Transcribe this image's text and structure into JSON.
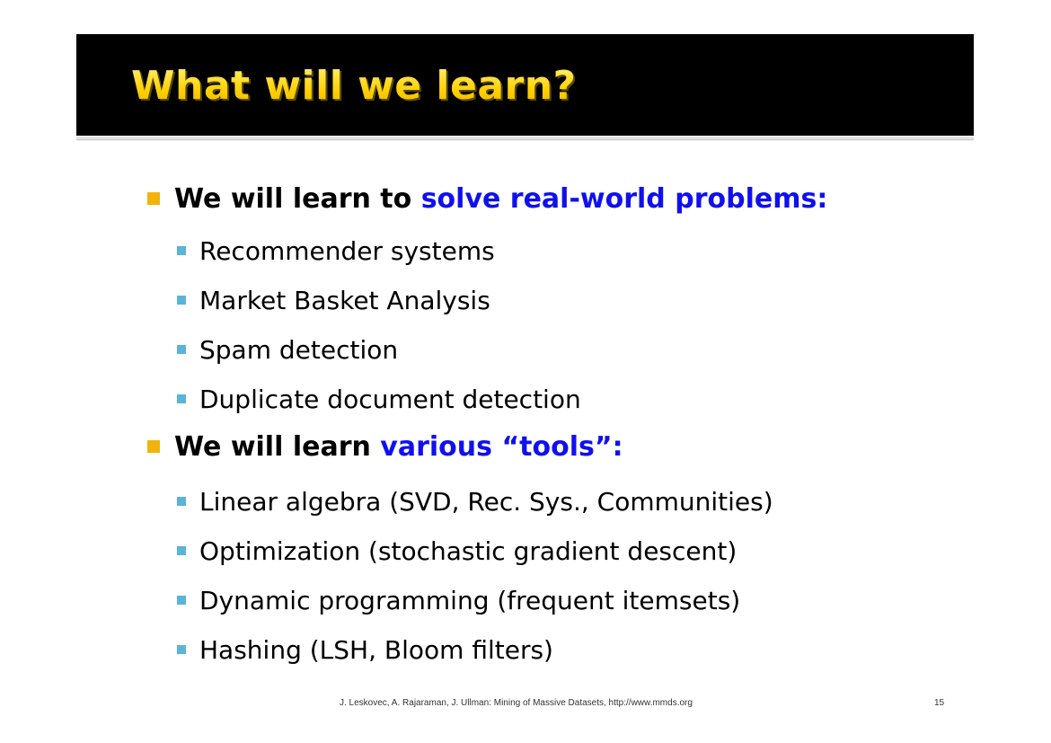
{
  "title": "What will we learn?",
  "sections": [
    {
      "lead": "We will learn to ",
      "highlight": "solve real-world problems:",
      "items": [
        "Recommender systems",
        "Market Basket Analysis",
        "Spam detection",
        "Duplicate document detection"
      ]
    },
    {
      "lead": "We will learn ",
      "highlight": "various “tools”:",
      "items": [
        "Linear algebra (SVD, Rec. Sys., Communities)",
        "Optimization (stochastic gradient descent)",
        "Dynamic programming (frequent itemsets)",
        "Hashing (LSH, Bloom filters)"
      ]
    }
  ],
  "footer": "J. Leskovec, A. Rajaraman, J. Ullman: Mining of Massive Datasets, http://www.mmds.org",
  "page_number": "15",
  "colors": {
    "title": "#ffd700",
    "highlight": "#1010ee",
    "bullet_l1": "#f2b40a",
    "bullet_l2": "#5ab4d8"
  }
}
